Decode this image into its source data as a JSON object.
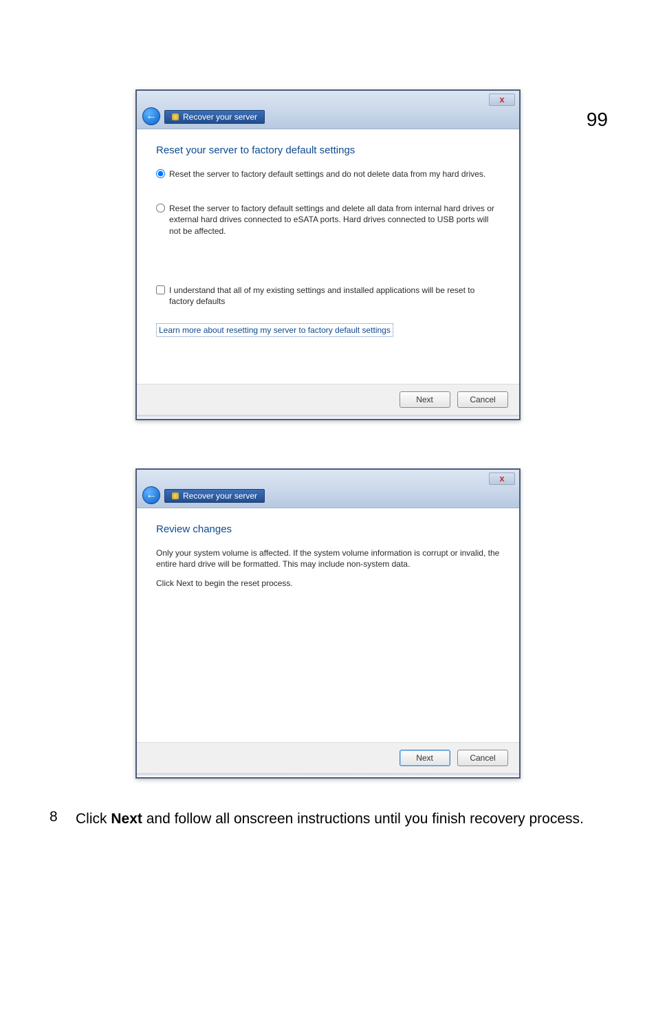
{
  "page_number": "99",
  "dialog1": {
    "close_label": "x",
    "breadcrumb_label": "Recover your server",
    "heading": "Reset your server to factory default settings",
    "radio1_label": "Reset the server to factory default settings and do not delete data from my hard drives.",
    "radio2_label": "Reset the server to factory default settings and delete all data from internal hard drives or external hard drives connected to eSATA ports. Hard drives connected to USB ports will not be affected.",
    "checkbox_label": "I understand that all of my existing settings and installed applications will be reset to factory defaults",
    "learn_more": "Learn more about resetting my server to factory default settings",
    "next_label": "Next",
    "cancel_label": "Cancel"
  },
  "dialog2": {
    "close_label": "x",
    "breadcrumb_label": "Recover your server",
    "heading": "Review changes",
    "para1": "Only your system volume is affected. If the system volume information is corrupt or invalid, the entire hard drive will be formatted. This may include non-system data.",
    "para2": "Click Next to begin the reset process.",
    "next_label": "Next",
    "cancel_label": "Cancel"
  },
  "instruction": {
    "step": "8",
    "prefix": "Click ",
    "bold": "Next",
    "suffix": " and follow all onscreen instructions until you finish recovery process."
  }
}
